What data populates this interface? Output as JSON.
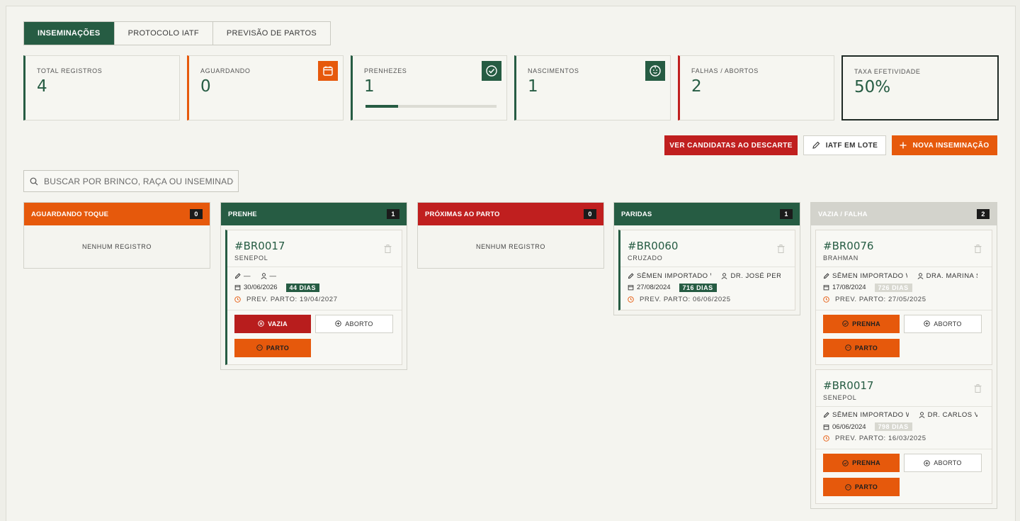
{
  "tabs": [
    "INSEMINAÇÕES",
    "PROTOCOLO IATF",
    "PREVISÃO DE PARTOS"
  ],
  "stats": {
    "total": {
      "label": "TOTAL REGISTROS",
      "value": "4"
    },
    "aguardando": {
      "label": "AGUARDANDO",
      "value": "0"
    },
    "prenhezes": {
      "label": "PRENHEZES",
      "value": "1",
      "progress": 0.25
    },
    "nascimentos": {
      "label": "NASCIMENTOS",
      "value": "1"
    },
    "falhas": {
      "label": "FALHAS / ABORTOS",
      "value": "2"
    },
    "taxa": {
      "label": "TAXA EFETIVIDADE",
      "value": "50%"
    }
  },
  "actions": {
    "descarte": "VER CANDIDATAS AO DESCARTE",
    "iatf_lote": "IATF EM LOTE",
    "nova": "NOVA INSEMINAÇÃO"
  },
  "search": {
    "placeholder": "BUSCAR POR BRINCO, RAÇA OU INSEMINADOR..."
  },
  "colors": {
    "green": "#265c43",
    "orange": "#e6590c",
    "red": "#c01f1f",
    "grey": "#d3d3cc"
  },
  "columns": {
    "aguardando": {
      "title": "AGUARDANDO TOQUE",
      "count": "0",
      "empty": "NENHUM REGISTRO"
    },
    "prenhe": {
      "title": "PRENHE",
      "count": "1",
      "card": {
        "id": "#BR0017",
        "breed": "SENEPOL",
        "semen": "—",
        "tech": "—",
        "date": "30/06/2026",
        "days": "44 DIAS",
        "prev": "PREV. PARTO: 19/04/2027",
        "btn1": "VAZIA",
        "btn2": "ABORTO",
        "btn3": "PARTO"
      }
    },
    "proximas": {
      "title": "PRÓXIMAS AO PARTO",
      "count": "0",
      "empty": "NENHUM REGISTRO"
    },
    "paridas": {
      "title": "PARIDAS",
      "count": "1",
      "card": {
        "id": "#BR0060",
        "breed": "CRUZADO",
        "semen": "SÊMEN IMPORTADO WAGYU",
        "tech": "DR. JOSÉ PEREIRA",
        "date": "27/08/2024",
        "days": "716 DIAS",
        "prev": "PREV. PARTO: 06/06/2025"
      }
    },
    "vazia": {
      "title": "VAZIA / FALHA",
      "count": "2",
      "cards": [
        {
          "id": "#BR0076",
          "breed": "BRAHMAN",
          "semen": "SÊMEN IMPORTADO WAGYU",
          "tech": "DRA. MARINA SILVA",
          "date": "17/08/2024",
          "days": "726 DIAS",
          "prev": "PREV. PARTO: 27/05/2025",
          "btn1": "PRENHA",
          "btn2": "ABORTO",
          "btn3": "PARTO"
        },
        {
          "id": "#BR0017",
          "breed": "SENEPOL",
          "semen": "SÊMEN IMPORTADO WAGYU",
          "tech": "DR. CARLOS VERA",
          "date": "06/06/2024",
          "days": "798 DIAS",
          "prev": "PREV. PARTO: 16/03/2025",
          "btn1": "PRENHA",
          "btn2": "ABORTO",
          "btn3": "PARTO"
        }
      ]
    }
  }
}
